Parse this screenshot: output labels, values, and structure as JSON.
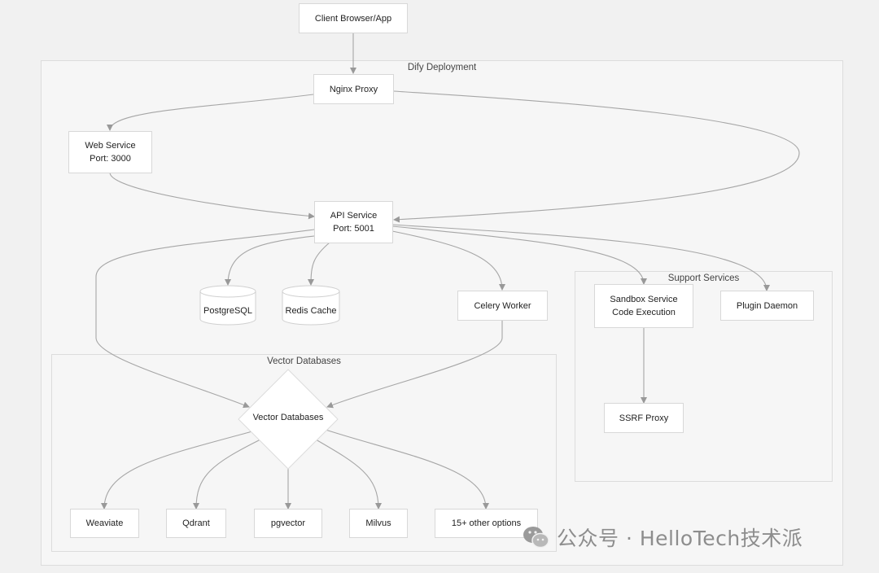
{
  "clusters": {
    "deployment": "Dify Deployment",
    "vector": "Vector Databases",
    "support": "Support Services"
  },
  "nodes": {
    "client": "Client Browser/App",
    "nginx": "Nginx Proxy",
    "web": "Web Service\nPort: 3000",
    "api": "API Service\nPort: 5001",
    "postgres": "PostgreSQL",
    "redis": "Redis Cache",
    "celery": "Celery Worker",
    "vector_hub": "Vector Databases",
    "sandbox": "Sandbox Service\nCode Execution",
    "plugin": "Plugin Daemon",
    "ssrf": "SSRF Proxy",
    "weaviate": "Weaviate",
    "qdrant": "Qdrant",
    "pgvector": "pgvector",
    "milvus": "Milvus",
    "other": "15+ other options"
  },
  "watermark": {
    "text": "公众号 · HelloTech技术派",
    "icon": "wechat-icon"
  },
  "colors": {
    "background": "#f1f1f1",
    "cluster_fill": "#f6f6f6",
    "edge": "#999999",
    "node_border": "#d8d8d8"
  }
}
